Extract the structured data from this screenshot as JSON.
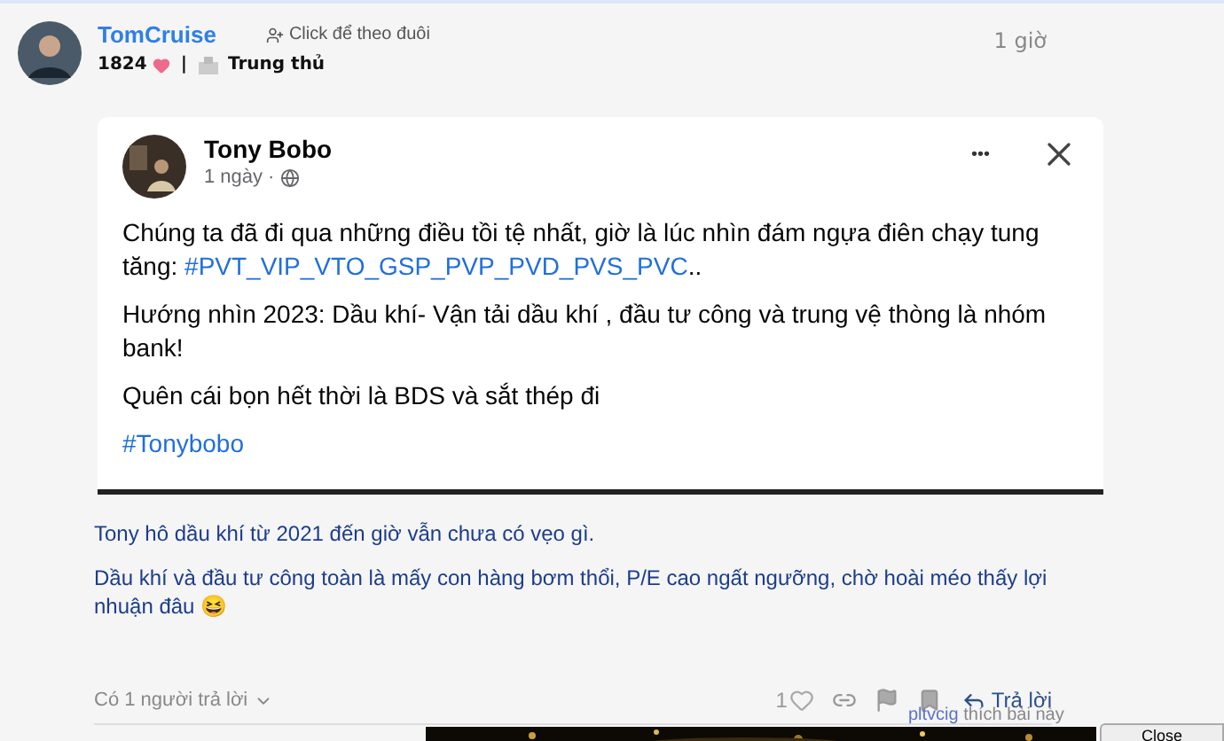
{
  "post": {
    "author": "TomCruise",
    "follow": "Click để theo đuôi",
    "score": "1824",
    "separator": "|",
    "rank": "Trung thủ",
    "time": "1 giờ"
  },
  "embed": {
    "author": "Tony Bobo",
    "time": "1 ngày",
    "dot": "·",
    "more": "•••",
    "paragraphs": [
      [
        "Chúng ta đã đi qua những điều tồi tệ nhất, giờ là lúc nhìn đám ngựa điên chạy tung tăng: ",
        {
          "link": "#PVT_VIP_VTO_GSP_PVP_PVD_PVS_PVC"
        },
        ".."
      ],
      [
        "Hướng nhìn 2023: Dầu khí- Vận tải dầu khí , đầu tư công và trung vệ thòng là nhóm bank!"
      ],
      [
        "Quên cái bọn hết thời là BDS và sắt thép đi"
      ],
      [
        {
          "link": "#Tonybobo"
        }
      ]
    ]
  },
  "comment": [
    "Tony hô dầu khí từ 2021 đến giờ vẫn chưa có vẹo gì.",
    "Dầu khí và đầu tư công toàn là mấy con hàng bơm thổi, P/E cao ngất ngưỡng, chờ hoài méo thấy lợi nhuận đâu 😆"
  ],
  "footer": {
    "replies": "Có 1 người trả lời",
    "likes": "1",
    "liked": false,
    "reply": "Trả lời",
    "liker": "pltvcig",
    "liker_text": "thích bài này"
  },
  "overlay": {
    "kind": "picture",
    "close": "Close"
  }
}
